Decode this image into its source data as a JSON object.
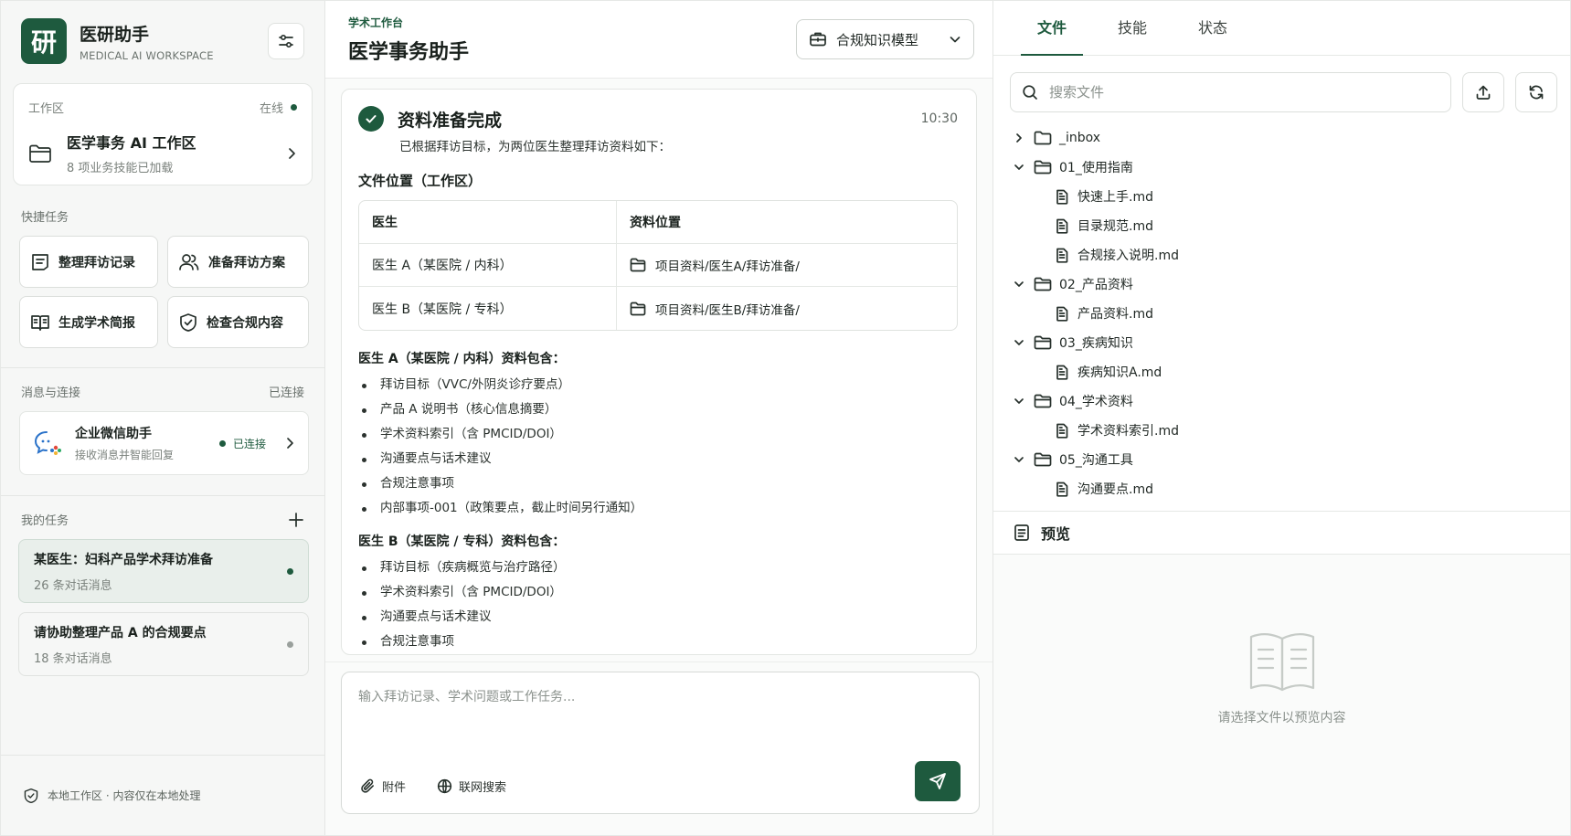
{
  "brand": {
    "logo_char": "研",
    "title": "医研助手",
    "subtitle": "MEDICAL AI WORKSPACE"
  },
  "workspace": {
    "section_label": "工作区",
    "status": "在线",
    "name": "医学事务 AI 工作区",
    "desc": "8 项业务技能已加载"
  },
  "quick_tasks": {
    "label": "快捷任务",
    "items": [
      {
        "label": "整理拜访记录",
        "icon": "notes-icon"
      },
      {
        "label": "准备拜访方案",
        "icon": "users-icon"
      },
      {
        "label": "生成学术简报",
        "icon": "book-icon"
      },
      {
        "label": "检查合规内容",
        "icon": "shield-check-icon"
      }
    ]
  },
  "connections": {
    "label": "消息与连接",
    "status": "已连接",
    "item": {
      "title": "企业微信助手",
      "sub": "接收消息并智能回复",
      "status": "已连接"
    }
  },
  "my_tasks": {
    "label": "我的任务",
    "items": [
      {
        "title": "某医生：妇科产品学术拜访准备",
        "sub": "26 条对话消息",
        "active": true
      },
      {
        "title": "请协助整理产品 A 的合规要点",
        "sub": "18 条对话消息",
        "active": false
      }
    ]
  },
  "footer": {
    "text": "本地工作区 · 内容仅在本地处理"
  },
  "center": {
    "crumb": "学术工作台",
    "title": "医学事务助手",
    "model": "合规知识模型",
    "message": {
      "title": "资料准备完成",
      "time": "10:30",
      "intro": "已根据拜访目标，为两位医生整理拜访资料如下：",
      "location_heading": "文件位置（工作区）",
      "table": {
        "headers": [
          "医生",
          "资料位置"
        ],
        "rows": [
          {
            "doctor": "医生 A（某医院 / 内科）",
            "path": "项目资料/医生A/拜访准备/"
          },
          {
            "doctor": "医生 B（某医院 / 专科）",
            "path": "项目资料/医生B/拜访准备/"
          }
        ]
      },
      "group_a": {
        "heading": "医生 A（某医院 / 内科）资料包含：",
        "items": [
          "拜访目标（VVC/外阴炎诊疗要点）",
          "产品 A 说明书（核心信息摘要）",
          "学术资料索引（含 PMCID/DOI）",
          "沟通要点与话术建议",
          "合规注意事项",
          "内部事项-001（政策要点，截止时间另行通知）"
        ]
      },
      "group_b": {
        "heading": "医生 B（某医院 / 专科）资料包含：",
        "items": [
          "拜访目标（疾病概览与治疗路径）",
          "学术资料索引（含 PMCID/DOI）",
          "沟通要点与话术建议",
          "合规注意事项"
        ]
      }
    },
    "composer": {
      "placeholder": "输入拜访记录、学术问题或工作任务...",
      "attach": "附件",
      "web_search": "联网搜索"
    }
  },
  "right": {
    "tabs": [
      "文件",
      "技能",
      "状态"
    ],
    "search_placeholder": "搜索文件",
    "tree": [
      {
        "type": "folder",
        "name": "_inbox",
        "expanded": false
      },
      {
        "type": "folder",
        "name": "01_使用指南",
        "expanded": true
      },
      {
        "type": "file",
        "name": "快速上手.md"
      },
      {
        "type": "file",
        "name": "目录规范.md"
      },
      {
        "type": "file",
        "name": "合规接入说明.md"
      },
      {
        "type": "folder",
        "name": "02_产品资料",
        "expanded": true
      },
      {
        "type": "file",
        "name": "产品资料.md"
      },
      {
        "type": "folder",
        "name": "03_疾病知识",
        "expanded": true
      },
      {
        "type": "file",
        "name": "疾病知识A.md"
      },
      {
        "type": "folder",
        "name": "04_学术资料",
        "expanded": true
      },
      {
        "type": "file",
        "name": "学术资料索引.md"
      },
      {
        "type": "folder",
        "name": "05_沟通工具",
        "expanded": true
      },
      {
        "type": "file",
        "name": "沟通要点.md"
      }
    ],
    "preview": {
      "title": "预览",
      "empty": "请选择文件以预览内容"
    }
  },
  "colors": {
    "accent": "#1e5a3e",
    "muted_dot": "#9aa09c"
  }
}
